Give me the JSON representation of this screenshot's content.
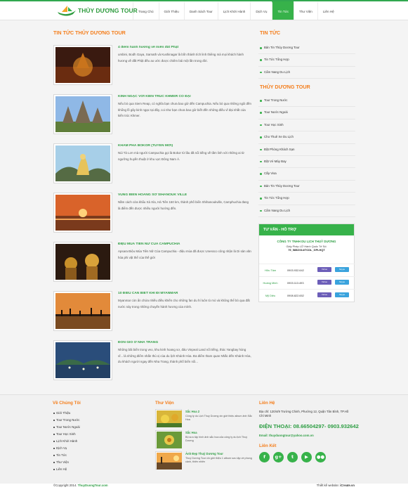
{
  "header": {
    "logo_text": "THỦY DƯƠNG TOUR",
    "nav": [
      "Trang Chủ",
      "Giới Thiệu",
      "Danh Sách Tour",
      "Lịch Khởi Hành",
      "Dịch Vụ",
      "Tin Tức",
      "Thư Viện",
      "Liên Hệ"
    ],
    "active_index": 5
  },
  "main": {
    "title": "TIN TỨC THỦY DƯƠNG TOUR",
    "news": [
      {
        "title": "4 điểm hành hương về miền đất Phật",
        "desc": "umbini, Bodh Gaya, Sarnath và Kushinagar là bốn thánh tích linh thiêng mà mọi khách hành hương về đất Phật đều ao ước được chiêm bái một lần trong đời."
      },
      {
        "title": "KINH NGẠC VỚI KIẾN TRÚC KHMER CỔ ĐẠI",
        "desc": "Nếu bỏ qua Siem Reap, có nghĩa bạn chưa bao giờ đến Campuchia. Nếu bỏ qua những ngôi đền khổng lồ gây kinh ngạc tại đây, coi như bạn chưa bao giờ biết đến những điều vĩ đại nhất của kiến trúc Khmer."
      },
      {
        "title": "KHÁM PHÁ BOKOR (TUYẾN MỚI)",
        "desc": "Núi Tà Lơn mà người Campuchia gọi là Bokor từ lâu đã nổi tiếng về tầm linh với những ai từ ngưỡng huyền thuật ở khu vực Đông Nam Á."
      },
      {
        "title": "VÙNG BIỂN HOANG SƠ SIHANOUK VILLE",
        "desc": "Nằm cách cửa khẩu Xà Xía, Hà Tiên 150 km, thành phố biển Shihanoukville, Camphuchia đang là điểm đến được nhiều người hướng đến."
      },
      {
        "title": "ĐIỆU MÚA TIÊN NỮ CỦA CAMPUCHIA",
        "desc": "Apsara Điệu Múa Tiên Nữ Của Campuchia - điệu múa đã được Unessco công nhận là Di sản văn hóa phi vật thể của thế giới"
      },
      {
        "title": "10 ĐIỀU CẦN BIẾT KHI ĐI MYANMAR",
        "desc": "Myanmar còn ẩn chứa nhiều điều khiến cho những fan du hí luôn tò mò và không thể bỏ qua đất nước này trong những chuyến hành hương của mình."
      },
      {
        "title": "ĐÓN GIÓ Ở NHA TRANG",
        "desc": "Những bãi biển trong veo, khu kinh hoang sơ, đảo Vinpeal Land nổi tiếng, thác Yangbay hùng vĩ... là những điểm nhấn thú vị của du lịch Khánh Hòa. Đa điểm tham quan Nhắc đến Khánh Hòa, du khách người ngay đến Nha Trang, thành phố biển nổi..."
      }
    ]
  },
  "sidebar": {
    "news_title": "TIN TỨC",
    "news_links": [
      "Bản Tin Thủy Dương Tour",
      "Tin Tức Tổng Hợp",
      "Cẩm Nang Du Lịch"
    ],
    "tour_title": "THỦY DƯƠNG TOUR",
    "tour_links": [
      "Tour Trong Nước",
      "Tour Nước Ngoài",
      "Tour Học Sinh",
      "Cho Thuê Xe Du Lịch",
      "Đặt Phòng Khách Sạn",
      "Đặt Vé Máy Bay",
      "Cấp Visa",
      "Bản Tin Thủy Dương Tour",
      "Tin Tức Tổng Hợp",
      "Cẩm Nang Du Lịch"
    ]
  },
  "support": {
    "title": "TƯ VẤN - HỖ TRỢ",
    "company": "CÔNG TY TNHH DU LỊCH THUỶ DƯƠNG",
    "license_line": "Giấy Phép LỮ Hành Quốc Tế Số:",
    "license_no": "79_585/2014/TCDL_GPLHQT",
    "contacts": [
      {
        "name": "Hữu Tâm",
        "phone": "0903.932.642",
        "btn1": "Yahoo",
        "btn2": "Skype"
      },
      {
        "name": "Hoàng Minh",
        "phone": "0903.113.493",
        "btn1": "Yahoo",
        "btn2": "Skype"
      },
      {
        "name": "Mỹ Diệu",
        "phone": "0908.822.652",
        "btn1": "Yahoo",
        "btn2": "Skype"
      }
    ]
  },
  "footer": {
    "about_title": "Về Chúng Tôi",
    "about_links": [
      "Giới Thiệu",
      "Tour Trong Nước",
      "Tour Nước Ngoài",
      "Tour Học Sinh",
      "Lịch Khởi Hành",
      "Dịch Vụ",
      "Tin Tức",
      "Thư Viện",
      "Liên Hệ"
    ],
    "library_title": "Thư Viện",
    "library": [
      {
        "title": "Sắc Hoa 2",
        "desc": "Công ty du Lịch Thuỷ Dương xin giới thiệu album ảnh Sắc Hoa"
      },
      {
        "title": "Sắc Hoa",
        "desc": "Bộ sưu tập hình ảnh sắc hoa của công ty du lịch Thuỷ Dương"
      },
      {
        "title": "Ảnh Đẹp Thuỷ Dương Tour",
        "desc": "Thuỷ Dương Tour xin giới thiệu 1 album sưu tập về phong cảnh, thiên nhiên"
      }
    ],
    "contact_title": "Liên Hệ",
    "address": "Địa chỉ: 120/4/9 Trường Chinh, Phường 12, Quận Tân Bình, TP.Hồ Chí Minh",
    "phone": "ĐIỆN THOẠI: 08.66504297- 0903.932642",
    "email": "Email: thuyduongtour@yahoo.com.vn",
    "connect_title": "Liên Kết",
    "socials": [
      "f",
      "g+",
      "t",
      "▶",
      "●●"
    ]
  },
  "bottom": {
    "copyright": "©Copyright 2014.",
    "site": "ThuyDuongTour.com",
    "designed_by": "Thiết kế website:",
    "designer": "iCreate.vn"
  }
}
